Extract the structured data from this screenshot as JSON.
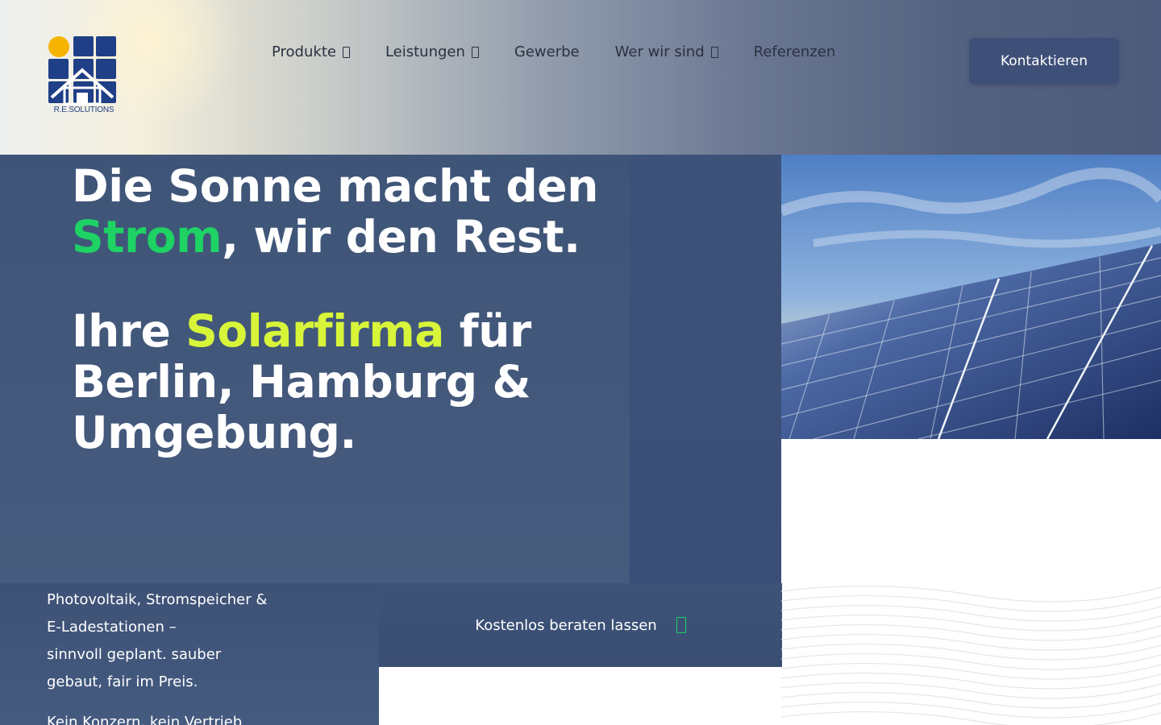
{
  "logo": {
    "text": "R.E.SOLUTIONS"
  },
  "nav": {
    "items": [
      {
        "label": "Produkte",
        "has_dropdown": true
      },
      {
        "label": "Leistungen",
        "has_dropdown": true
      },
      {
        "label": "Gewerbe",
        "has_dropdown": false
      },
      {
        "label": "Wer wir sind",
        "has_dropdown": true
      },
      {
        "label": "Referenzen",
        "has_dropdown": false
      }
    ],
    "cta_label": "Kontaktieren"
  },
  "hero": {
    "line1": "Die Sonne macht den",
    "line2_highlight": "Strom",
    "line2_rest": ", wir den Rest.",
    "line3_pre": "Ihre ",
    "line3_highlight": "Solarfirma",
    "line3_post": " für",
    "line4": "Berlin, Hamburg &",
    "line5": "Umgebung."
  },
  "subcopy": {
    "line1": "Photovoltaik, Stromspeicher &",
    "line2": "E-Ladestationen –",
    "line3": "sinnvoll geplant. sauber",
    "line4": "gebaut, fair im Preis.",
    "line5": "Kein Konzern, kein Vertrieb"
  },
  "consult": {
    "label": "Kostenlos beraten lassen"
  },
  "colors": {
    "accent_green": "#1ed264",
    "accent_lime": "#d8f53a",
    "navy": "#3f5078",
    "logo_blue": "#1f3f87",
    "logo_sun": "#f5b400"
  },
  "icons": [
    "chevron-down-icon",
    "arrow-right-icon",
    "logo-icon",
    "solar-panel-photo"
  ]
}
